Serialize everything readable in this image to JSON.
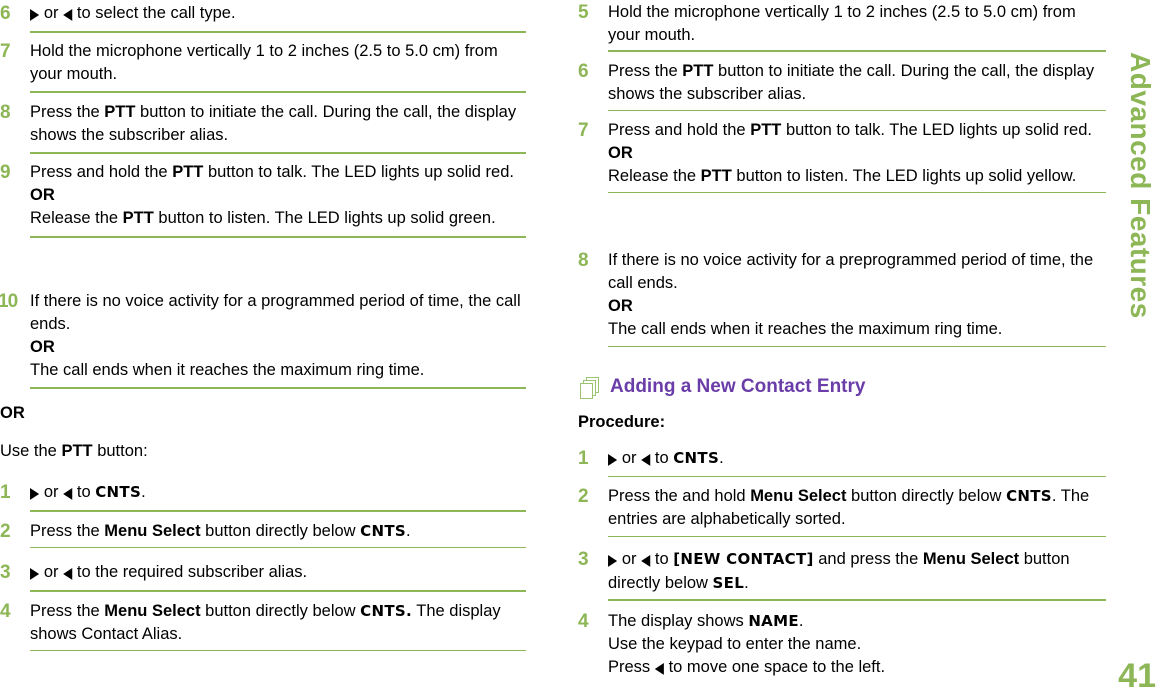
{
  "side_title": "Advanced Features",
  "page_number": "41",
  "left": {
    "steps_a": [
      {
        "num": "6",
        "parts": [
          {
            "t": "arrow",
            "v": "▶"
          },
          {
            "t": "text",
            "v": " or "
          },
          {
            "t": "arrow",
            "v": "◀"
          },
          {
            "t": "text",
            "v": " to select the call type."
          }
        ]
      },
      {
        "num": "7",
        "parts": [
          {
            "t": "text",
            "v": "Hold the microphone vertically 1 to 2 inches (2.5 to 5.0 cm) from your mouth."
          }
        ]
      },
      {
        "num": "8",
        "parts": [
          {
            "t": "text",
            "v": "Press the "
          },
          {
            "t": "bold",
            "v": "PTT"
          },
          {
            "t": "text",
            "v": " button to initiate the call. During the call, the display shows the subscriber alias."
          }
        ]
      },
      {
        "num": "9",
        "parts": [
          {
            "t": "text",
            "v": "Press and hold the "
          },
          {
            "t": "bold",
            "v": "PTT"
          },
          {
            "t": "text",
            "v": " button to talk. The LED lights up solid red."
          },
          {
            "t": "br"
          },
          {
            "t": "bold",
            "v": "OR"
          },
          {
            "t": "br"
          },
          {
            "t": "text",
            "v": "Release the "
          },
          {
            "t": "bold",
            "v": "PTT"
          },
          {
            "t": "text",
            "v": " button to listen. The LED lights up solid green."
          }
        ]
      },
      {
        "num": "10",
        "parts": [
          {
            "t": "text",
            "v": "If there is no voice activity for a programmed period of time, the call ends."
          },
          {
            "t": "br"
          },
          {
            "t": "bold",
            "v": "OR"
          },
          {
            "t": "br"
          },
          {
            "t": "text",
            "v": "The call ends when it reaches the maximum ring time."
          }
        ]
      }
    ],
    "or_label": "OR",
    "use_ptt": {
      "pre": "Use the ",
      "bold": "PTT",
      "post": " button:"
    },
    "steps_b": [
      {
        "num": "1",
        "parts": [
          {
            "t": "arrow",
            "v": "▶"
          },
          {
            "t": "text",
            "v": " or "
          },
          {
            "t": "arrow",
            "v": "◀"
          },
          {
            "t": "text",
            "v": " to "
          },
          {
            "t": "lcd",
            "v": "CNTS"
          },
          {
            "t": "text",
            "v": "."
          }
        ]
      },
      {
        "num": "2",
        "parts": [
          {
            "t": "text",
            "v": "Press the "
          },
          {
            "t": "bold",
            "v": "Menu Select"
          },
          {
            "t": "text",
            "v": " button directly below "
          },
          {
            "t": "lcd",
            "v": "CNTS"
          },
          {
            "t": "text",
            "v": "."
          }
        ]
      },
      {
        "num": "3",
        "parts": [
          {
            "t": "arrow",
            "v": "▶"
          },
          {
            "t": "text",
            "v": " or "
          },
          {
            "t": "arrow",
            "v": "◀"
          },
          {
            "t": "text",
            "v": " to the required subscriber alias."
          }
        ]
      },
      {
        "num": "4",
        "parts": [
          {
            "t": "text",
            "v": "Press the "
          },
          {
            "t": "bold",
            "v": "Menu Select"
          },
          {
            "t": "text",
            "v": " button directly below "
          },
          {
            "t": "lcd",
            "v": "CNTS."
          },
          {
            "t": "text",
            "v": " The display shows Contact Alias."
          }
        ]
      }
    ]
  },
  "right": {
    "steps_a": [
      {
        "num": "5",
        "parts": [
          {
            "t": "text",
            "v": "Hold the microphone vertically 1 to 2 inches (2.5 to 5.0 cm) from your mouth."
          }
        ]
      },
      {
        "num": "6",
        "parts": [
          {
            "t": "text",
            "v": "Press the "
          },
          {
            "t": "bold",
            "v": "PTT"
          },
          {
            "t": "text",
            "v": " button to initiate the call. During the call, the display shows the subscriber alias."
          }
        ]
      },
      {
        "num": "7",
        "parts": [
          {
            "t": "text",
            "v": "Press and hold the "
          },
          {
            "t": "bold",
            "v": "PTT"
          },
          {
            "t": "text",
            "v": " button to talk. The LED lights up solid red."
          },
          {
            "t": "br"
          },
          {
            "t": "bold",
            "v": "OR"
          },
          {
            "t": "br"
          },
          {
            "t": "text",
            "v": "Release the "
          },
          {
            "t": "bold",
            "v": "PTT"
          },
          {
            "t": "text",
            "v": " button to listen. The LED lights up solid yellow."
          }
        ]
      },
      {
        "num": "8",
        "parts": [
          {
            "t": "text",
            "v": "If there is no voice activity for a preprogrammed period of time, the call ends."
          },
          {
            "t": "br"
          },
          {
            "t": "bold",
            "v": "OR"
          },
          {
            "t": "br"
          },
          {
            "t": "text",
            "v": "The call ends when it reaches the maximum ring time."
          }
        ]
      }
    ],
    "section_title": "Adding a New Contact Entry",
    "procedure_label": "Procedure:",
    "steps_b": [
      {
        "num": "1",
        "parts": [
          {
            "t": "arrow",
            "v": "▶"
          },
          {
            "t": "text",
            "v": " or "
          },
          {
            "t": "arrow",
            "v": "◀"
          },
          {
            "t": "text",
            "v": " to "
          },
          {
            "t": "lcd",
            "v": "CNTS"
          },
          {
            "t": "text",
            "v": "."
          }
        ]
      },
      {
        "num": "2",
        "parts": [
          {
            "t": "text",
            "v": "Press the and hold "
          },
          {
            "t": "bold",
            "v": "Menu Select"
          },
          {
            "t": "text",
            "v": " button directly below "
          },
          {
            "t": "lcd",
            "v": "CNTS"
          },
          {
            "t": "text",
            "v": ". The entries are alphabetically sorted."
          }
        ]
      },
      {
        "num": "3",
        "parts": [
          {
            "t": "arrow",
            "v": "▶"
          },
          {
            "t": "text",
            "v": " or "
          },
          {
            "t": "arrow",
            "v": "◀"
          },
          {
            "t": "text",
            "v": " to "
          },
          {
            "t": "lcd",
            "v": "[NEW CONTACT]"
          },
          {
            "t": "text",
            "v": " and press the "
          },
          {
            "t": "bold",
            "v": "Menu Select"
          },
          {
            "t": "text",
            "v": " button directly below "
          },
          {
            "t": "lcd",
            "v": "SEL"
          },
          {
            "t": "text",
            "v": "."
          }
        ]
      },
      {
        "num": "4",
        "parts": [
          {
            "t": "text",
            "v": "The display shows "
          },
          {
            "t": "lcd",
            "v": "NAME"
          },
          {
            "t": "text",
            "v": "."
          },
          {
            "t": "br"
          },
          {
            "t": "text",
            "v": "Use the keypad to enter the name."
          },
          {
            "t": "br"
          },
          {
            "t": "text",
            "v": "Press "
          },
          {
            "t": "arrow",
            "v": "◀"
          },
          {
            "t": "text",
            "v": " to move one space to the left."
          }
        ]
      }
    ]
  }
}
